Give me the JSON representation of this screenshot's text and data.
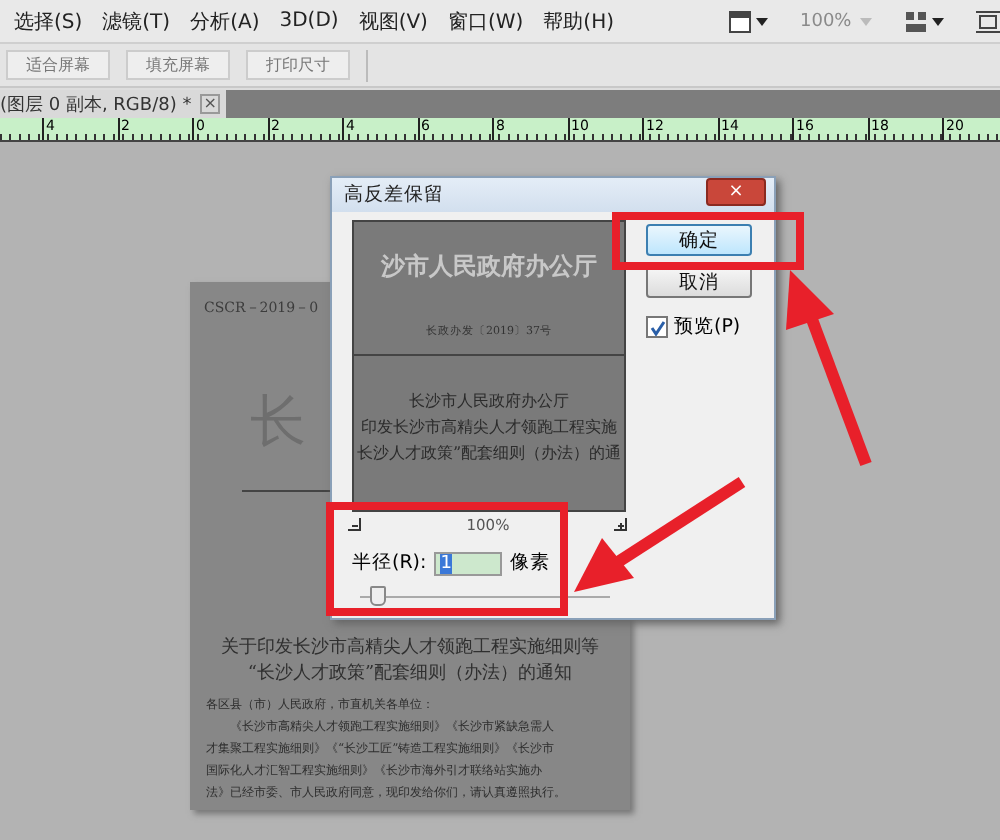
{
  "menu": [
    {
      "label": "选择(S)"
    },
    {
      "label": "滤镜(T)"
    },
    {
      "label": "分析(A)"
    },
    {
      "label": "3D(D)"
    },
    {
      "label": "视图(V)"
    },
    {
      "label": "窗口(W)"
    },
    {
      "label": "帮助(H)"
    }
  ],
  "toolbar": {
    "zoom": "100%"
  },
  "options_buttons": [
    "适合屏幕",
    "填充屏幕",
    "打印尺寸"
  ],
  "document_tab": {
    "title": "(图层 0 副本, RGB/8) *",
    "close": "×"
  },
  "ruler": {
    "ticks": [
      "4",
      "2",
      "0",
      "2",
      "4",
      "6",
      "8",
      "10",
      "12",
      "14",
      "16",
      "18",
      "20"
    ]
  },
  "document": {
    "code": "CSCR－2019－0",
    "title": "长",
    "heading": [
      "关于印发长沙市高精尖人才领跑工程实施细则等",
      "“长沙人才政策”配套细则（办法）的通知"
    ],
    "body": [
      "各区县（市）人民政府，市直机关各单位：",
      "《长沙市高精尖人才领跑工程实施细则》《长沙市紧缺急需人",
      "才集聚工程实施细则》《“长沙工匠”铸造工程实施细则》《长沙市",
      "国际化人才汇智工程实施细则》《长沙市海外引才联络站实施办",
      "法》已经市委、市人民政府同意，现印发给你们，请认真遵照执行。"
    ]
  },
  "dialog": {
    "title": "高反差保留",
    "close": "×",
    "preview_lines": [
      {
        "kind": "title",
        "text": "沙市人民政府办公厅"
      },
      {
        "kind": "number",
        "text": "长政办发〔2019〕37号"
      },
      {
        "kind": "heading",
        "text": "长沙市人民政府办公厅"
      },
      {
        "kind": "heading",
        "text": "印发长沙市高精尖人才领跑工程实施"
      },
      {
        "kind": "heading",
        "text": "长沙人才政策”配套细则（办法）的通"
      }
    ],
    "zoom": "100%",
    "radius_label": "半径(R):",
    "radius_value": "1",
    "radius_unit": "像素",
    "slider": {
      "level": 0.04
    },
    "buttons": [
      {
        "label": "确定",
        "highlighted": true
      },
      {
        "label": "取消",
        "highlighted": false
      }
    ],
    "preview": {
      "label": "预览(P)",
      "checked": true
    }
  }
}
